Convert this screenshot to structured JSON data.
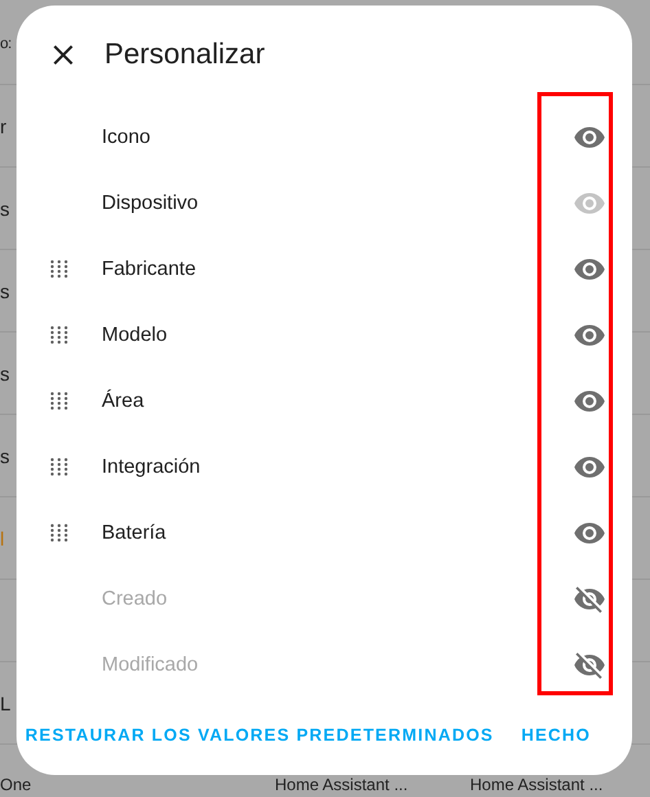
{
  "background": {
    "rows": [
      {
        "cells": [
          "o:"
        ]
      },
      {
        "cells": [
          "r"
        ]
      },
      {
        "cells": [
          "s"
        ]
      },
      {
        "cells": [
          "s"
        ]
      },
      {
        "cells": [
          "s"
        ]
      },
      {
        "cells": [
          "s"
        ]
      },
      {
        "cells": [
          "l"
        ],
        "color": "#b8730f"
      },
      {
        "cells": []
      },
      {
        "cells": [
          "L"
        ]
      },
      {
        "cells": [
          "One",
          "Home Assistant ...",
          "Home Assistant ..."
        ]
      }
    ]
  },
  "dialog": {
    "title": "Personalizar",
    "items": [
      {
        "label": "Icono",
        "draggable": false,
        "visible": true,
        "disabled": false
      },
      {
        "label": "Dispositivo",
        "draggable": false,
        "visible": true,
        "disabled": true
      },
      {
        "label": "Fabricante",
        "draggable": true,
        "visible": true,
        "disabled": false
      },
      {
        "label": "Modelo",
        "draggable": true,
        "visible": true,
        "disabled": false
      },
      {
        "label": "Área",
        "draggable": true,
        "visible": true,
        "disabled": false
      },
      {
        "label": "Integración",
        "draggable": true,
        "visible": true,
        "disabled": false
      },
      {
        "label": "Batería",
        "draggable": true,
        "visible": true,
        "disabled": false
      },
      {
        "label": "Creado",
        "draggable": false,
        "visible": false,
        "disabled": false
      },
      {
        "label": "Modificado",
        "draggable": false,
        "visible": false,
        "disabled": false
      }
    ],
    "buttons": [
      "RESTAURAR LOS VALORES PREDETERMINADOS",
      "HECHO"
    ]
  }
}
